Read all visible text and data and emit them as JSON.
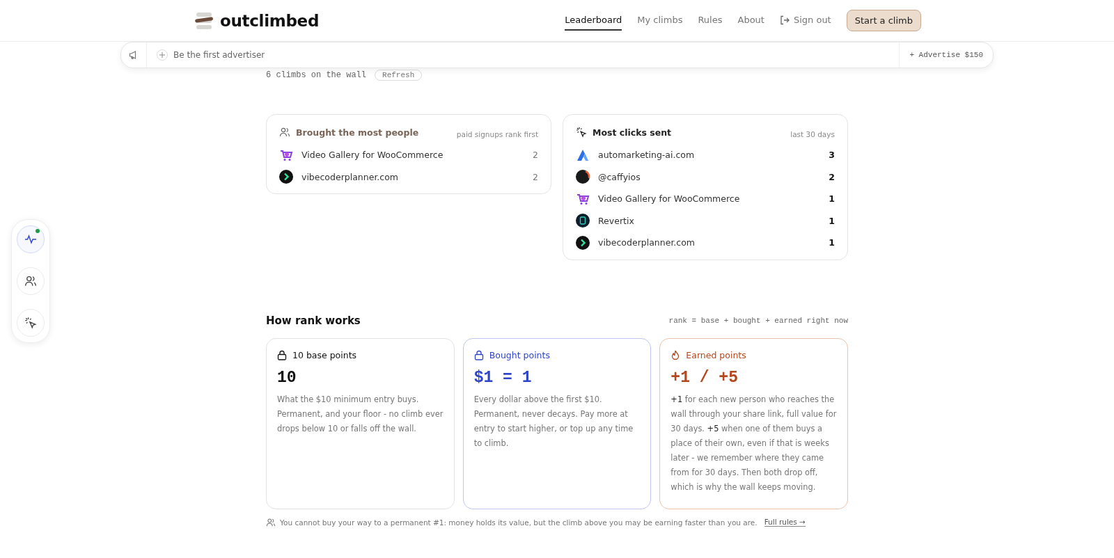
{
  "header": {
    "logo": "outclimbed",
    "nav": [
      {
        "label": "Leaderboard",
        "selected": true
      },
      {
        "label": "My climbs",
        "selected": false
      },
      {
        "label": "Rules",
        "selected": false
      },
      {
        "label": "About",
        "selected": false
      }
    ],
    "sign_out": "Sign out",
    "cta": "Start a climb"
  },
  "ad_bar": {
    "text": "Be the first advertiser",
    "action": "+ Advertise $150"
  },
  "wall": {
    "count": "6 climbs on the wall",
    "refresh": "Refresh"
  },
  "boards": [
    {
      "kind": "people",
      "title": "Brought the most people",
      "note": "paid signups rank first",
      "rows": [
        {
          "kind": "cart",
          "name": "Video Gallery for WooCommerce",
          "count": "2"
        },
        {
          "kind": "chevron",
          "name": "vibecoderplanner.com",
          "count": "2"
        }
      ]
    },
    {
      "kind": "clicks",
      "title": "Most clicks sent",
      "note": "last 30 days",
      "rows": [
        {
          "kind": "a-mark",
          "name": "automarketing-ai.com",
          "count": "3"
        },
        {
          "kind": "dark-disc",
          "name": "@caffyios",
          "count": "2"
        },
        {
          "kind": "cart",
          "name": "Video Gallery for WooCommerce",
          "count": "1"
        },
        {
          "kind": "square",
          "name": "Revertix",
          "count": "1"
        },
        {
          "kind": "chevron",
          "name": "vibecoderplanner.com",
          "count": "1"
        }
      ]
    }
  ],
  "rank": {
    "title": "How rank works",
    "formula": "rank = base + bought + earned right now",
    "cards": [
      {
        "kind": "base",
        "title": "10 base points",
        "value": "10",
        "text": "What the $10 minimum entry buys. Permanent, and your floor - no climb ever drops below 10 or falls off the wall."
      },
      {
        "kind": "bought",
        "title": "Bought points",
        "value": "$1 = 1",
        "text": "Every dollar above the first $10. Permanent, never decays. Pay more at entry to start higher, or top up any time to climb."
      },
      {
        "kind": "earned",
        "title": "Earned points",
        "value": "+1 / +5",
        "text": "**+1** for each new person who reaches the wall through your share link, full value for 30 days. **+5** when one of them buys a place of their own, even if that is weeks later - we remember where they came from for 30 days. Then both drop off, which is why the wall keeps moving."
      }
    ],
    "footnote": "You cannot buy your way to a permanent #1: money holds its value, but the climb above you may be earning faster than you are.",
    "link": "Full rules →"
  },
  "side_panel": [
    {
      "kind": "activity",
      "selected": true,
      "badge": true
    },
    {
      "kind": "people",
      "selected": false,
      "badge": false
    },
    {
      "kind": "clicks",
      "selected": false,
      "badge": false
    }
  ]
}
